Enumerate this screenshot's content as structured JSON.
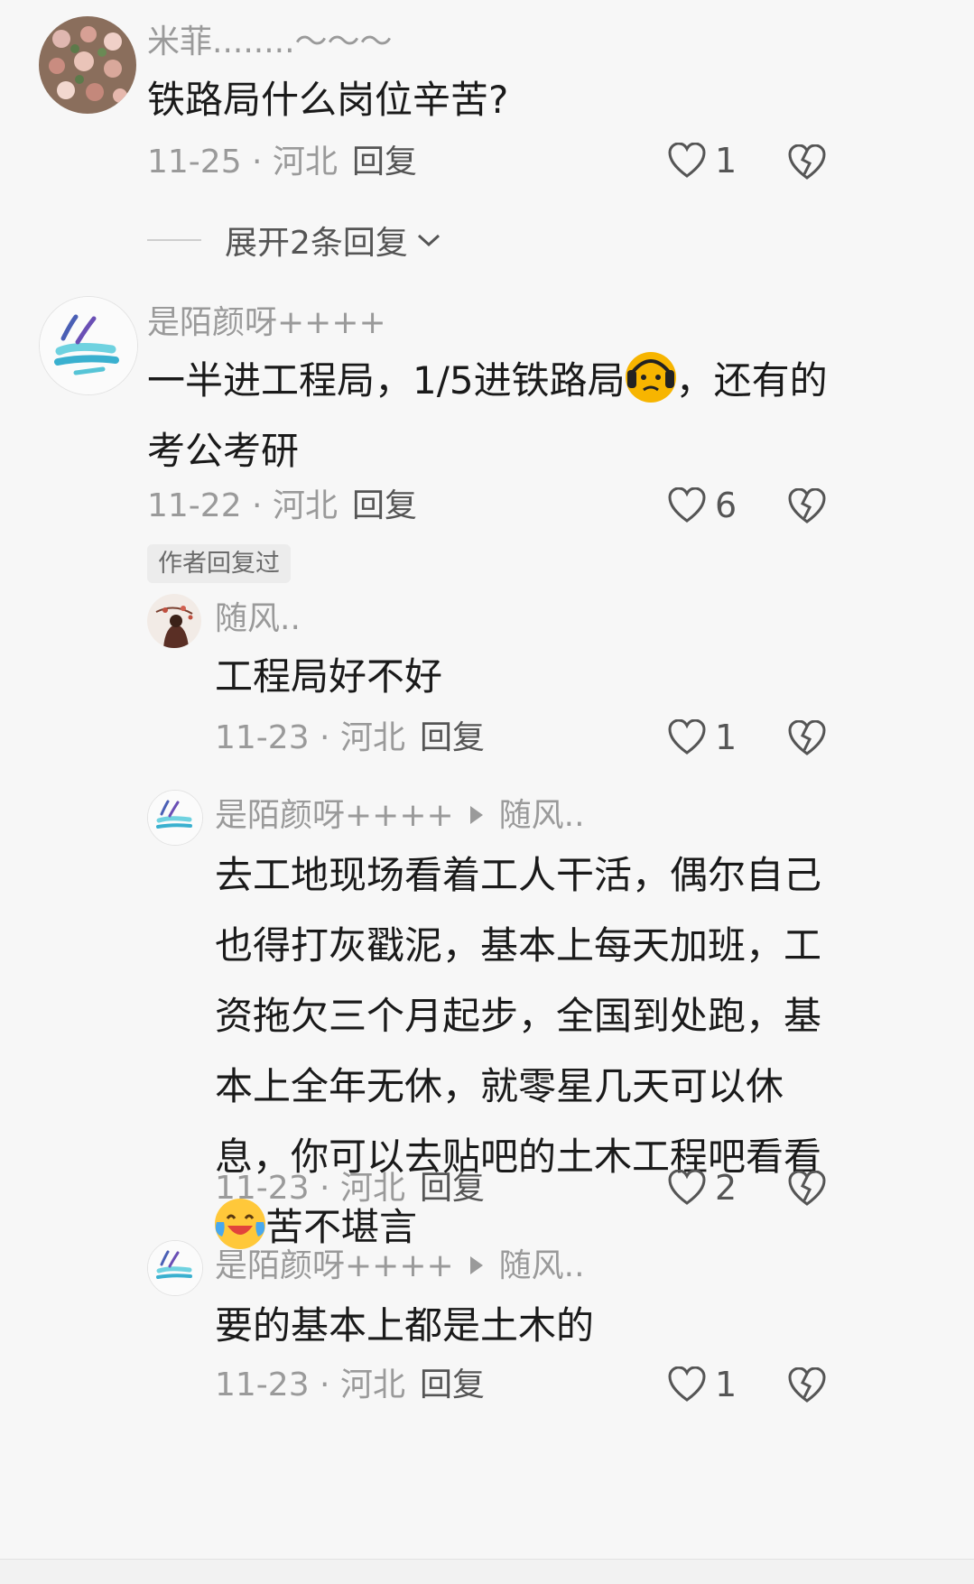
{
  "comments": [
    {
      "user": "米菲........～～～",
      "text": "铁路局什么岗位辛苦?",
      "meta": "11-25 · 河北",
      "reply_label": "回复",
      "likes": "1",
      "expand_label": "展开2条回复"
    },
    {
      "user": "是陌颜呀++++",
      "text_before_emoji": "一半进工程局，1/5进铁路局",
      "text_after_emoji": "，还有的考公考研",
      "meta": "11-22 · 河北",
      "reply_label": "回复",
      "likes": "6",
      "badge": "作者回复过",
      "replies": [
        {
          "user": "随风..",
          "text": "工程局好不好",
          "meta": "11-23 · 河北",
          "reply_label": "回复",
          "likes": "1"
        },
        {
          "user": "是陌颜呀++++",
          "reply_to": "随风..",
          "text_before_emoji": "去工地现场看着工人干活，偶尔自己也得打灰戳泥，基本上每天加班，工资拖欠三个月起步，全国到处跑，基本上全年无休，就零星几天可以休息，你可以去贴吧的土木工程吧看看",
          "text_after_emoji": "苦不堪言",
          "meta": "11-23 · 河北",
          "reply_label": "回复",
          "likes": "2"
        },
        {
          "user": "是陌颜呀++++",
          "reply_to": "随风..",
          "text": "要的基本上都是土木的",
          "meta": "11-23 · 河北",
          "reply_label": "回复",
          "likes": "1"
        }
      ]
    }
  ],
  "icons": {
    "like": "heart-outline-icon",
    "dislike": "broken-heart-icon",
    "expand": "chevron-down-icon",
    "emoji1": "headphone-sad-emoji",
    "emoji2": "crying-laughing-emoji"
  },
  "colors": {
    "background": "#f7f7f7",
    "text": "#1a1a1a",
    "muted": "#9a9a9a"
  }
}
